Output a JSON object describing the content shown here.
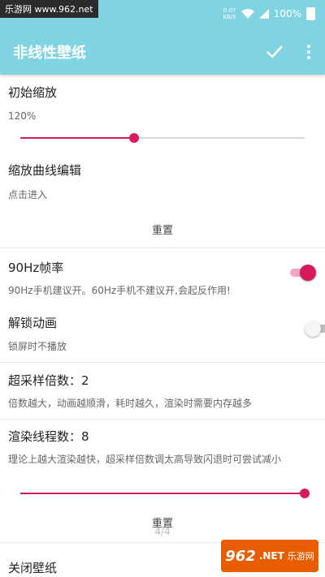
{
  "status_bar": {
    "watermark": "乐游网 www.962.net",
    "net_speed_value": "0.07",
    "net_speed_unit": "KB/S",
    "battery": "100%"
  },
  "app_bar": {
    "title": "非线性壁纸",
    "confirm_icon": "check-icon",
    "more_icon": "more-vert-icon"
  },
  "colors": {
    "accent": "#d81b60",
    "appbar": "#7fd3e3",
    "track_inactive": "#d9d9d9"
  },
  "settings": {
    "initial_zoom": {
      "title": "初始缩放",
      "value": "120%",
      "slider_fraction": 0.4
    },
    "zoom_curve": {
      "title": "缩放曲线编辑",
      "subtitle": "点击进入",
      "reset": "重置"
    },
    "fps90": {
      "title": "90Hz帧率",
      "subtitle": "90Hz手机建议开。60Hz手机不建议开,会起反作用!",
      "enabled": true
    },
    "unlock_anim": {
      "title": "解锁动画",
      "subtitle": "锁屏时不播放",
      "enabled": false
    },
    "supersampling": {
      "title": "超采样倍数：2",
      "subtitle": "倍数越大，动画越顺滑，耗时越久，渲染时需要内存越多"
    },
    "render_threads": {
      "title": "渲染线程数：8",
      "subtitle": "理论上越大渲染越快，超采样倍数调太高导致闪退时可尝试减小",
      "slider_fraction": 1.0,
      "reset": "重置"
    },
    "page_indicator": "4/4",
    "close_wallpaper": {
      "title": "关闭壁纸"
    }
  },
  "corner_badge": {
    "number": "962",
    "suffix": ".NET",
    "label": "乐游网"
  }
}
